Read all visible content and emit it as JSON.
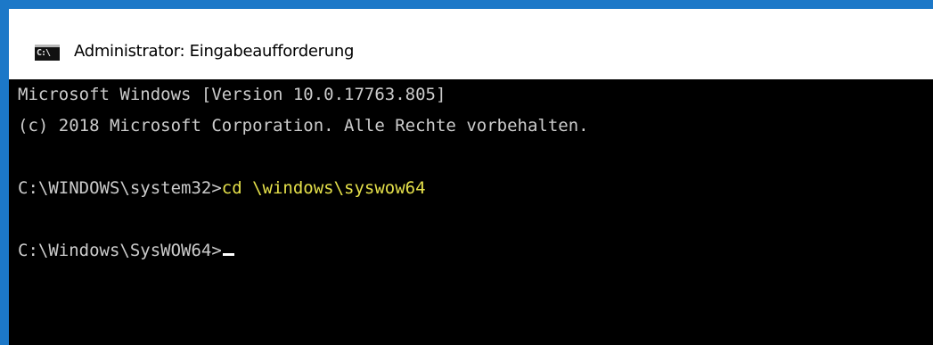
{
  "window": {
    "title": "Administrator: Eingabeaufforderung",
    "icon": "C:\\",
    "icon_name": "command-prompt-icon"
  },
  "console": {
    "lines": [
      "Microsoft Windows [Version 10.0.17763.805]",
      "(c) 2018 Microsoft Corporation. Alle Rechte vorbehalten.",
      "",
      "C:\\WINDOWS\\system32>",
      "",
      "C:\\Windows\\SysWOW64>"
    ],
    "command": "cd \\windows\\syswow64"
  },
  "colors": {
    "desktop": "#1c78c8",
    "console_bg": "#000000",
    "console_text": "#cccccc",
    "command_text": "#e5e04a",
    "titlebar": "#ffffff"
  }
}
